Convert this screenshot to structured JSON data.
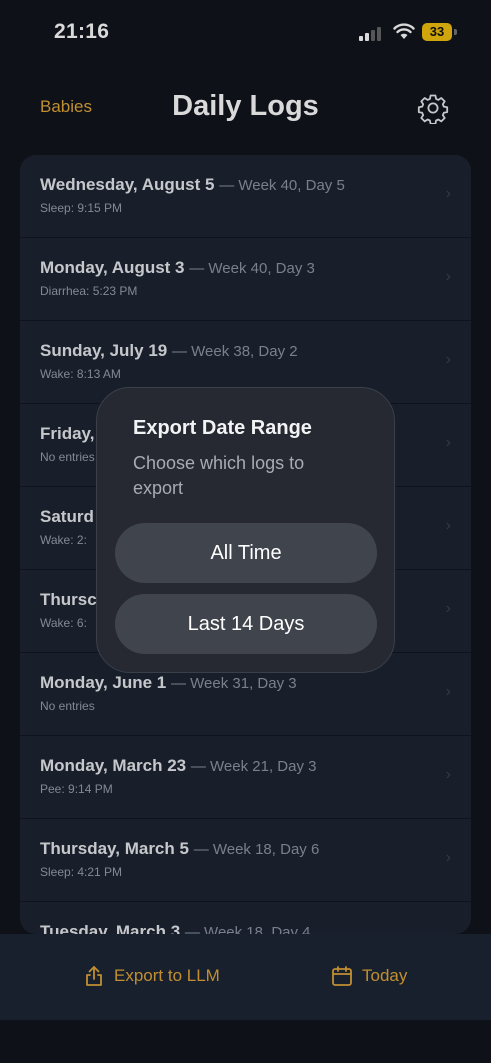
{
  "status_bar": {
    "time": "21:16",
    "battery": "33"
  },
  "nav": {
    "left_label": "Babies",
    "title": "Daily Logs",
    "right_icon": "gear-icon"
  },
  "logs": [
    {
      "date": "Wednesday, August 5",
      "week": "— Week 40, Day 5",
      "detail": "Sleep: 9:15 PM"
    },
    {
      "date": "Monday, August 3",
      "week": "— Week 40, Day 3",
      "detail": "Diarrhea: 5:23 PM"
    },
    {
      "date": "Sunday, July 19",
      "week": "— Week 38, Day 2",
      "detail": "Wake: 8:13 AM"
    },
    {
      "date": "Friday,",
      "week": "",
      "detail": "No entries"
    },
    {
      "date": "Saturd",
      "week": "",
      "detail": "Wake: 2:"
    },
    {
      "date": "Thursc",
      "week": "",
      "detail": "Wake: 6:"
    },
    {
      "date": "Monday, June 1",
      "week": "— Week 31, Day 3",
      "detail": "No entries"
    },
    {
      "date": "Monday, March 23",
      "week": "— Week 21, Day 3",
      "detail": "Pee: 9:14 PM"
    },
    {
      "date": "Thursday, March 5",
      "week": "— Week 18, Day 6",
      "detail": "Sleep: 4:21 PM"
    },
    {
      "date": "Tuesday, March 3",
      "week": "— Week 18, Day 4",
      "detail": ""
    }
  ],
  "bottom_bar": {
    "export_label": "Export to LLM",
    "today_label": "Today"
  },
  "dialog": {
    "title": "Export Date Range",
    "message": "Choose which logs to export",
    "option_all": "All Time",
    "option_14": "Last 14 Days"
  },
  "colors": {
    "accent": "#e2a83a",
    "background": "#11151d",
    "card": "#1d2533",
    "battery": "#f4c20d"
  }
}
